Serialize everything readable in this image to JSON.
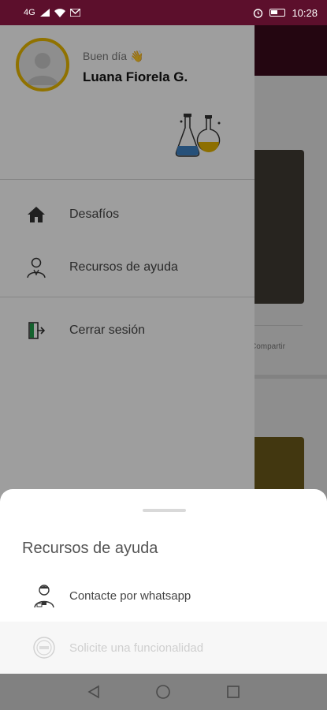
{
  "status_bar": {
    "signal_text": "4G",
    "time": "10:28"
  },
  "drawer": {
    "greeting": "Buen día 👋",
    "user_name": "Luana Fiorela G.",
    "menu": [
      {
        "label": "Desafíos",
        "icon": "home-icon"
      },
      {
        "label": "Recursos de ayuda",
        "icon": "person-icon"
      }
    ],
    "logout_label": "Cerrar sesión"
  },
  "background": {
    "share_text": "Compartir"
  },
  "sheet": {
    "title": "Recursos de ayuda",
    "items": [
      {
        "label": "Contacte por whatsapp",
        "icon": "support-person-icon"
      },
      {
        "label": "Solicite una funcionalidad",
        "icon": "request-badge-icon"
      }
    ]
  },
  "colors": {
    "status_bar": "#5c0f2c",
    "avatar_ring": "#e8b800",
    "logout_icon_green": "#1f9e4a"
  }
}
